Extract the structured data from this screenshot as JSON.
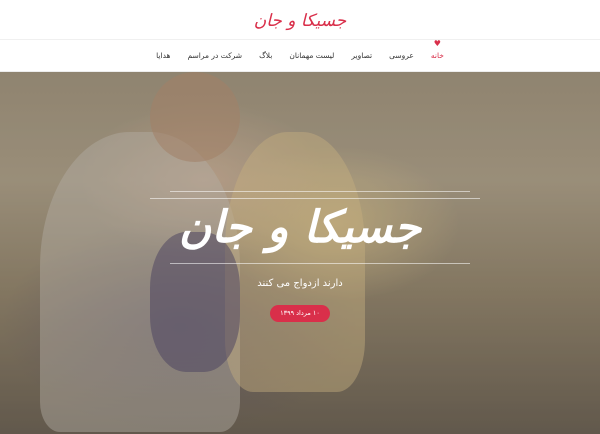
{
  "site": {
    "logo": "جسیکا و جان"
  },
  "nav": {
    "items": [
      {
        "label": "خانه",
        "active": true
      },
      {
        "label": "عروسی",
        "active": false
      },
      {
        "label": "تصاویر",
        "active": false
      },
      {
        "label": "لیست مهمانان",
        "active": false
      },
      {
        "label": "بلاگ",
        "active": false
      },
      {
        "label": "شرکت در مراسم",
        "active": false
      },
      {
        "label": "هدایا",
        "active": false
      }
    ],
    "active_icon": "heart-icon"
  },
  "hero": {
    "title": "جسیکا و جان",
    "subtitle": "دارند ازدواج می کنند",
    "date_button": "۱۰ مرداد ۱۳۹۹"
  },
  "colors": {
    "accent": "#d92f4a"
  }
}
